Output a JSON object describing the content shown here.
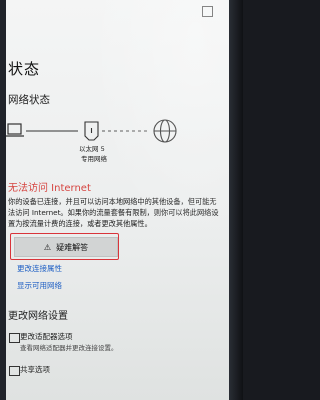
{
  "page": {
    "title": "状态"
  },
  "network_status": {
    "heading": "网络状态",
    "adapter_name": "以太网 5",
    "network_type": "专用网络"
  },
  "error": {
    "title": "无法访问 Internet",
    "description": "你的设备已连接，并且可以访问本地网络中的其他设备，但可能无法访问 Internet。如果你的流量套餐有限制，则你可以将此网络设置为按流量计费的连接，或者更改其他属性。"
  },
  "actions": {
    "troubleshoot_label": "疑难解答",
    "change_properties": "更改连接属性",
    "show_networks": "显示可用网络"
  },
  "change_settings": {
    "heading": "更改网络设置",
    "adapter_options_label": "更改适配器选项",
    "adapter_options_desc": "查看网络适配器并更改连接设置。",
    "sharing_label": "共享选项"
  },
  "colors": {
    "error": "#d64541",
    "link": "#1f5fc4",
    "highlight": "#d9343a"
  }
}
